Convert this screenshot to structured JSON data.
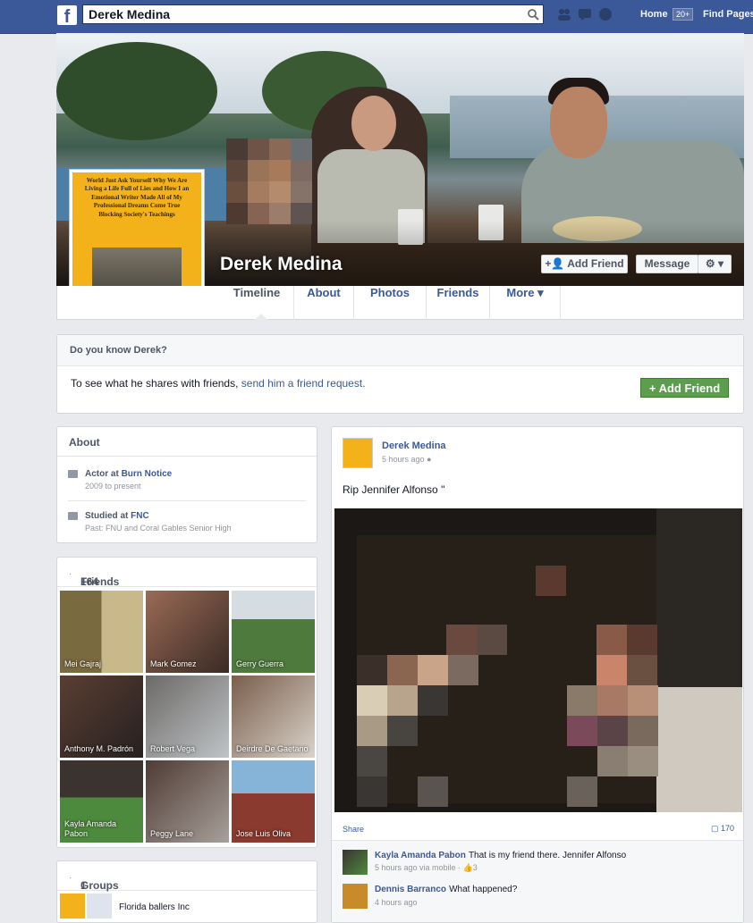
{
  "topbar": {
    "search_value": "Derek Medina",
    "home": "Home",
    "home_badge": "20+",
    "find": "Find Pages"
  },
  "profile": {
    "name": "Derek Medina",
    "add_friend": "Add Friend",
    "message": "Message",
    "avatar_text": "World Just Ask Yourself Why We Are Living a Life Full of Lies and How I an Emotional Writer Made All of My Professional Dreams Come True Blocking Society's Teachings"
  },
  "tabs": [
    "Timeline",
    "About",
    "Photos",
    "Friends",
    "More"
  ],
  "know": {
    "title": "Do you know Derek?",
    "text": "To see what he shares with friends,",
    "link": "send him a friend request.",
    "button": "Add Friend"
  },
  "about": {
    "title": "About",
    "items": [
      {
        "prefix": "Actor at",
        "org": "Burn Notice",
        "sub": "2009 to present"
      },
      {
        "prefix": "Studied at",
        "org": "FNC",
        "sub": "Past: FNU and Coral Gables Senior High"
      }
    ]
  },
  "friends": {
    "title": "Friends",
    "count": "164",
    "list": [
      "Mei Gajraj",
      "Mark Gomez",
      "Gerry Guerra",
      "Anthony M. Padrón",
      "Robert Vega",
      "Deirdre De Gaetano",
      "Kayla Amanda Pabon",
      "Peggy Lane",
      "Jose Luis Oliva"
    ]
  },
  "groups": {
    "title": "Groups",
    "count": "1",
    "first": "Florida ballers Inc"
  },
  "post": {
    "author": "Derek Medina",
    "time": "5 hours ago",
    "text": "Rip Jennifer Alfonso \"",
    "share": "Share",
    "share_count": "170",
    "comments": [
      {
        "name": "Kayla Amanda Pabon",
        "text": "That is my friend there. Jennifer Alfonso",
        "meta": "5 hours ago via mobile · ",
        "likes": "3"
      },
      {
        "name": "Dennis Barranco",
        "text": "What happened?",
        "meta": "4 hours ago"
      }
    ]
  },
  "colors": {
    "brand": "#3b5998",
    "green": "#5b9e4d",
    "avatar_bg": "#f3b21a"
  }
}
